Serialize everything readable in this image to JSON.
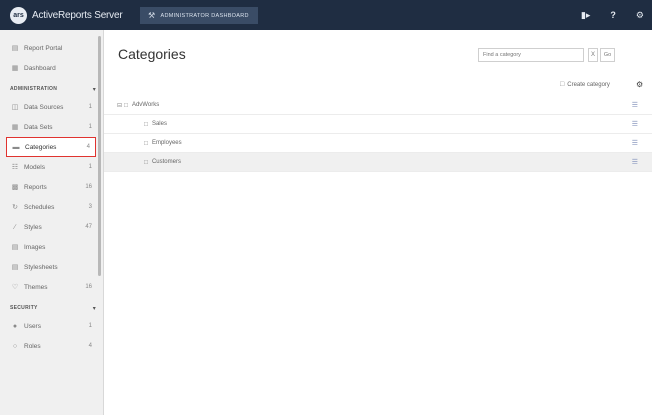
{
  "topbar": {
    "logo_text": "ars",
    "app_title": "ActiveReports Server",
    "dashboard_tab": "ADMINISTRATOR DASHBOARD",
    "icons": [
      "logout-icon",
      "help-icon",
      "settings-icon"
    ],
    "help_glyph": "?"
  },
  "sidebar": {
    "top_items": [
      {
        "label": "Report Portal",
        "icon": "portal-icon"
      },
      {
        "label": "Dashboard",
        "icon": "dashboard-icon"
      }
    ],
    "sections": [
      {
        "title": "ADMINISTRATION",
        "items": [
          {
            "label": "Data Sources",
            "count": "1"
          },
          {
            "label": "Data Sets",
            "count": "1"
          },
          {
            "label": "Categories",
            "count": "4"
          },
          {
            "label": "Models",
            "count": "1"
          },
          {
            "label": "Reports",
            "count": "16"
          },
          {
            "label": "Schedules",
            "count": "3"
          },
          {
            "label": "Styles",
            "count": "47"
          },
          {
            "label": "Images",
            "count": ""
          },
          {
            "label": "Stylesheets",
            "count": ""
          },
          {
            "label": "Themes",
            "count": "16"
          }
        ]
      },
      {
        "title": "SECURITY",
        "items": [
          {
            "label": "Users",
            "count": "1"
          },
          {
            "label": "Roles",
            "count": "4"
          }
        ]
      }
    ],
    "active_item": "Categories"
  },
  "main": {
    "title": "Categories",
    "search": {
      "placeholder": "Find a category",
      "value": "",
      "clear_label": "X",
      "go_label": "Go"
    },
    "create_label": "Create category",
    "tree": [
      {
        "label": "AdvWorks",
        "level": 0,
        "expanded": true
      },
      {
        "label": "Sales",
        "level": 1
      },
      {
        "label": "Employees",
        "level": 1
      },
      {
        "label": "Customers",
        "level": 1,
        "highlighted": true
      }
    ]
  },
  "colors": {
    "topbar": "#1f2d42",
    "active_border": "#e0332f",
    "sidebar_bg": "#f0f0f0"
  }
}
